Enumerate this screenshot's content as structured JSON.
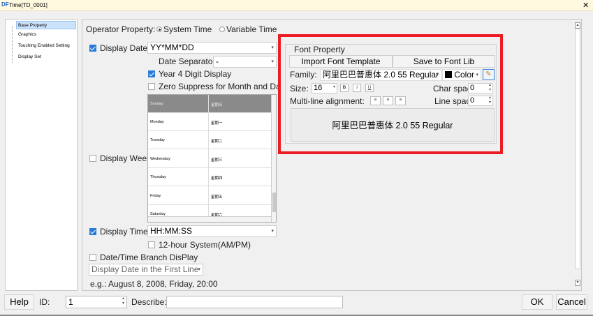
{
  "window": {
    "title": "Time[TD_0001]",
    "logo": "DF",
    "close": "✕"
  },
  "nav": {
    "items": [
      "Base Property",
      "Graphics",
      "Touching Enabled Setting",
      "Display Set"
    ]
  },
  "operator": {
    "label": "Operator Property:",
    "options": [
      "System Time",
      "Variable Time"
    ],
    "selected": "System Time"
  },
  "date": {
    "display_label": "Display Date",
    "display_checked": true,
    "format_value": "YY*MM*DD",
    "separator_label": "Date Separator",
    "separator_value": "-",
    "year4_label": "Year 4 Digit Display",
    "year4_checked": true,
    "zero_label": "Zero Suppress for Month and Day",
    "zero_checked": false
  },
  "week": {
    "label": "Display Week",
    "checked": false,
    "rows": [
      [
        "Sunday",
        "星期日"
      ],
      [
        "Monday",
        "星期一"
      ],
      [
        "Tuesday",
        "星期二"
      ],
      [
        "Wednesday",
        "星期三"
      ],
      [
        "Thursday",
        "星期四"
      ],
      [
        "Friday",
        "星期五"
      ],
      [
        "Saturday",
        "星期六"
      ]
    ]
  },
  "time": {
    "display_label": "Display Time",
    "display_checked": true,
    "format_value": "HH:MM:SS",
    "hour12_label": "12-hour System(AM/PM)",
    "hour12_checked": false,
    "branch_label": "Date/Time Branch DisPlay",
    "branch_checked": false,
    "first_line_value": "Display Date in the First Line",
    "example": "e.g.: August 8, 2008, Friday, 20:00"
  },
  "font": {
    "group_title": "Font Property",
    "import_label": "Import  Font Template",
    "save_label": "Save to Font Lib",
    "family_label": "Family:",
    "family_value": "阿里巴巴普惠体 2.0 55 Regular",
    "color_label": "Color",
    "size_label": "Size:",
    "size_value": "16",
    "style_buttons": [
      "B",
      "I",
      "U"
    ],
    "charspace_label": "Char spac",
    "charspace_value": "0",
    "align_label": "Multi-line alignment:",
    "linespace_label": "Line spac",
    "linespace_value": "0",
    "preview_text": "阿里巴巴普惠体 2.0 55 Regular",
    "highlight_color": "#ec1c24"
  },
  "footer": {
    "help_label": "Help",
    "id_label": "ID:",
    "id_value": "1",
    "describe_label": "Describe:",
    "describe_value": "",
    "ok_label": "OK",
    "cancel_label": "Cancel"
  }
}
